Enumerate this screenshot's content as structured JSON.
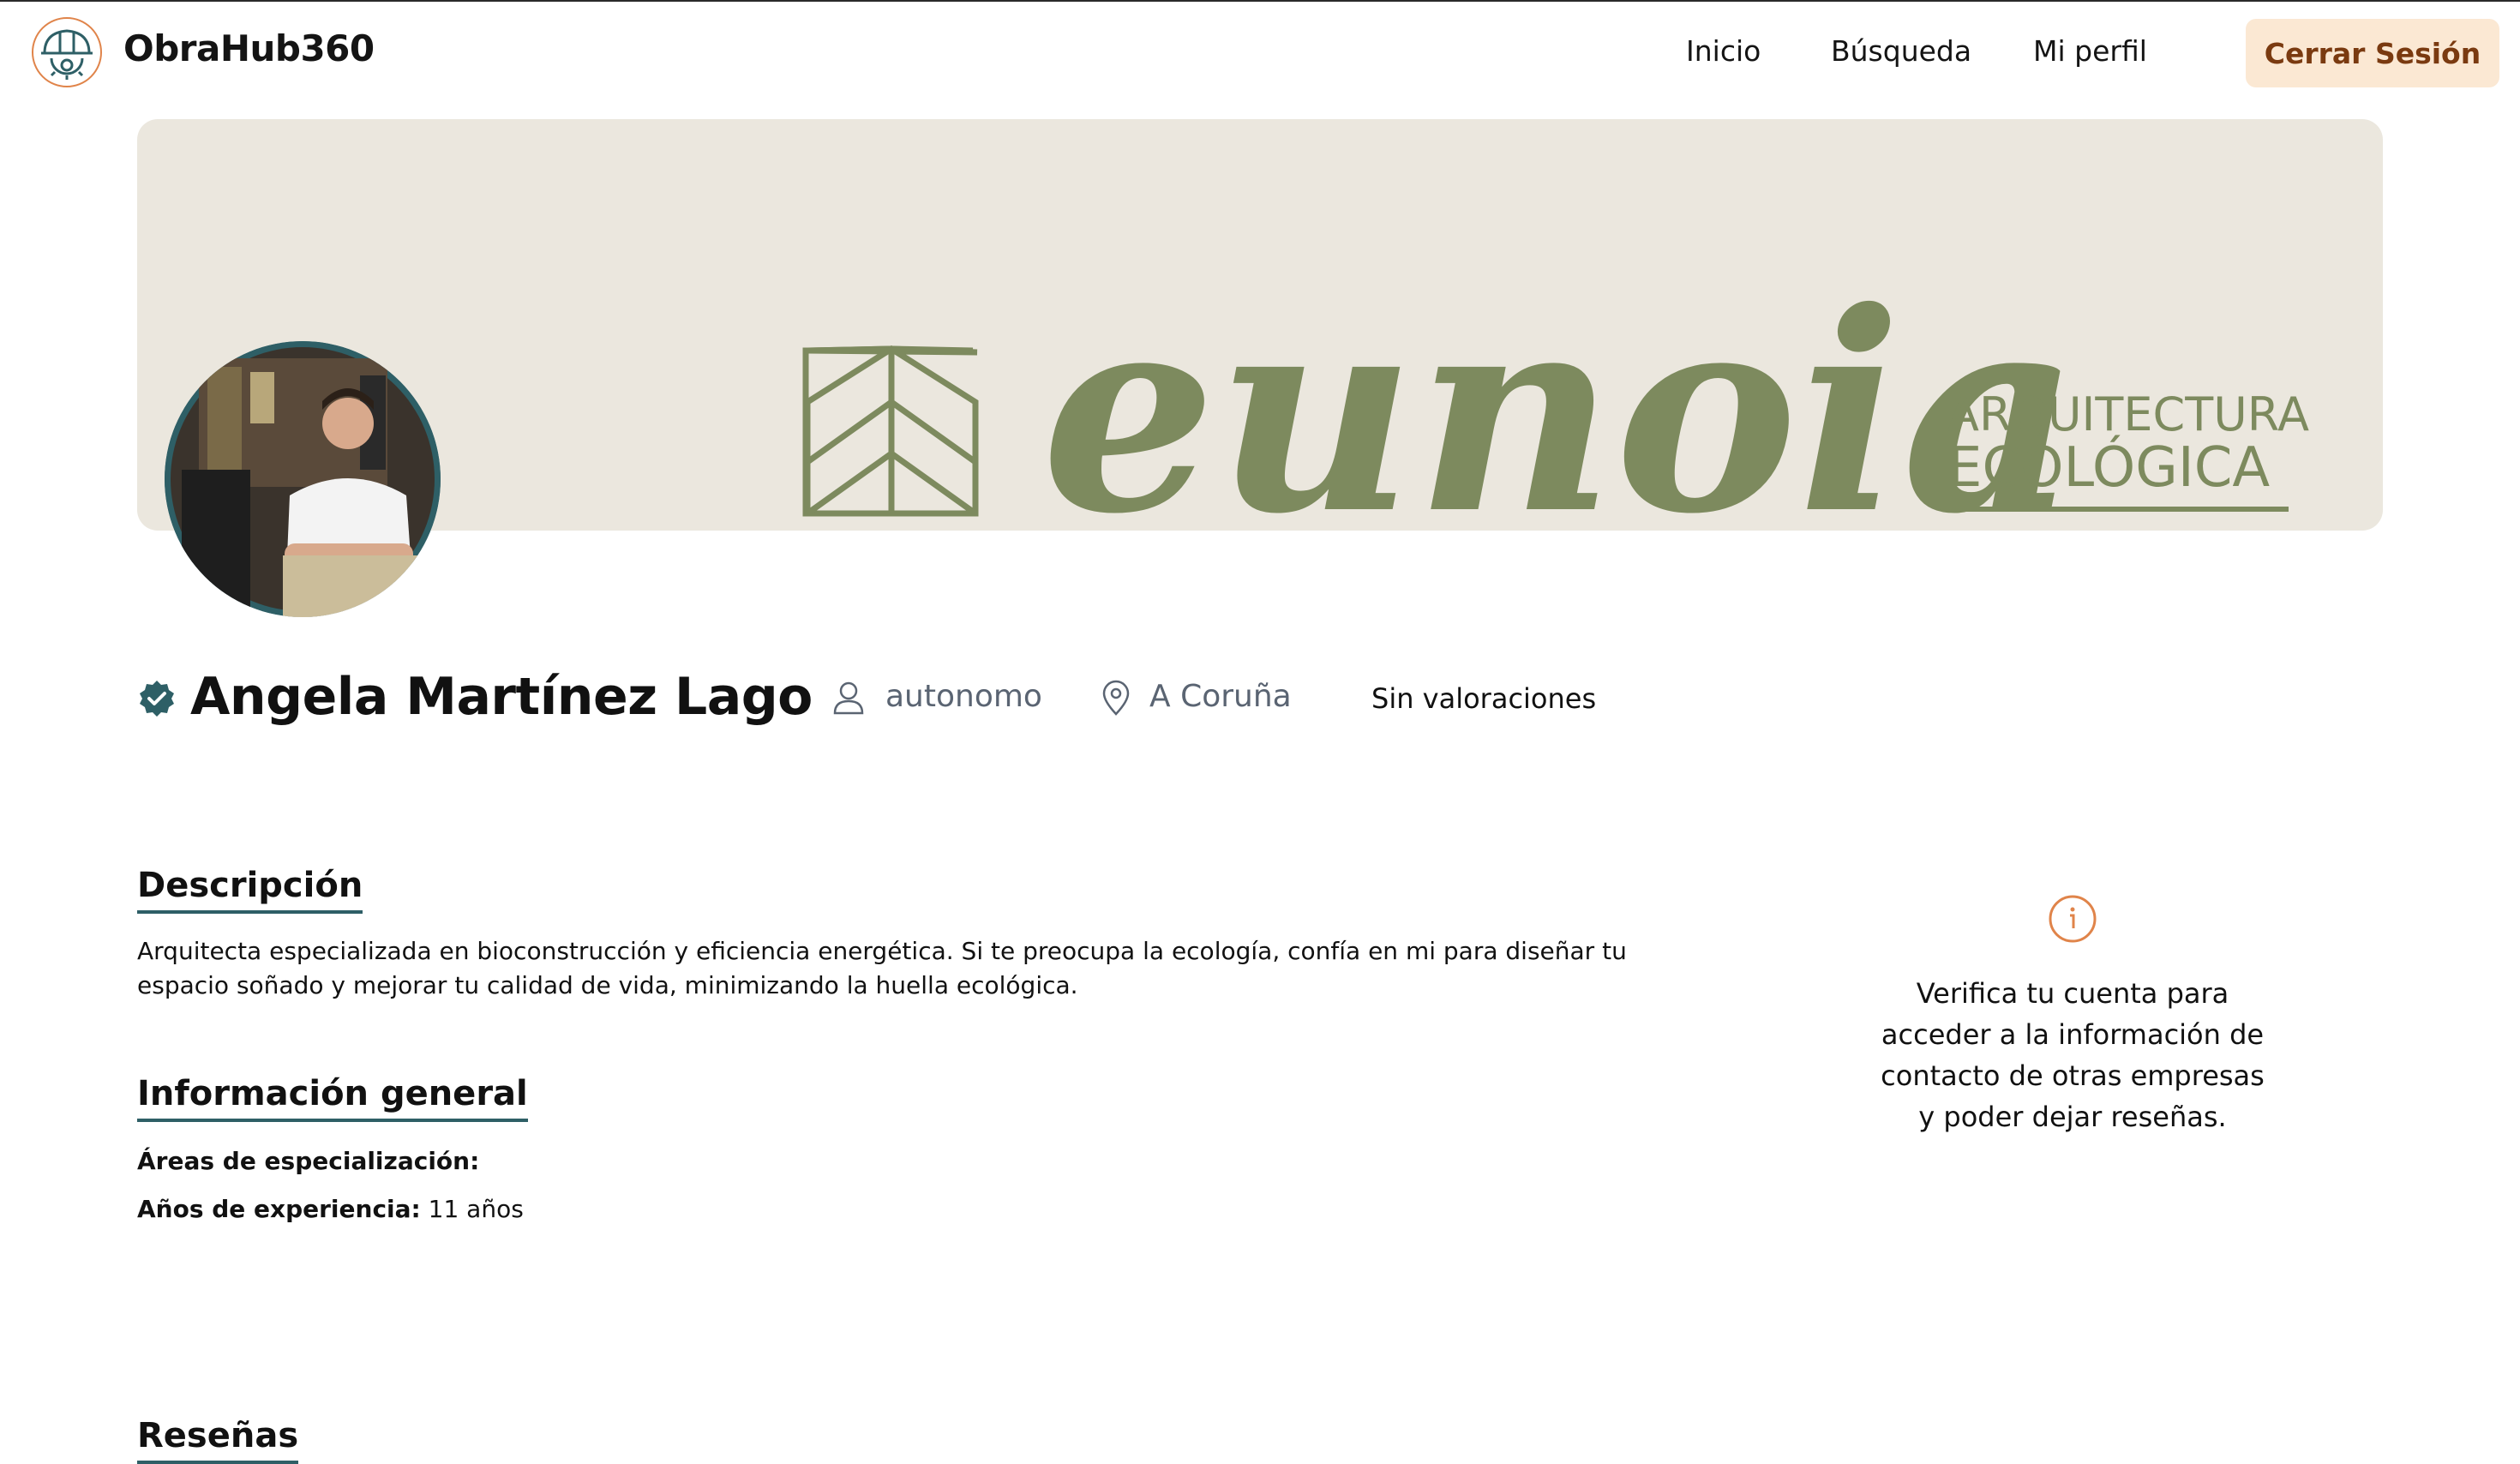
{
  "brand": {
    "name": "ObraHub360"
  },
  "nav": {
    "links": [
      "Inicio",
      "Búsqueda",
      "Mi perfil"
    ],
    "logout_label": "Cerrar Sesión"
  },
  "banner": {
    "logo_word": "eunoia",
    "tagline_line1": "ARQUITECTURA",
    "tagline_line2": "ECOLÓGICA"
  },
  "profile": {
    "name": "Angela Martínez Lago",
    "verified": true,
    "type": "autonomo",
    "location": "A Coruña",
    "ratings": "Sin valoraciones"
  },
  "description": {
    "title": "Descripción",
    "text": "Arquitecta especializada en bioconstrucción y eficiencia energética.  Si te preocupa la ecología, confía en mi para diseñar tu espacio soñado y mejorar tu calidad de vida, minimizando la huella ecológica."
  },
  "general_info": {
    "title": "Información general",
    "specialization_label": "Áreas de especialización:",
    "specialization_value": "",
    "experience_label": "Años de experiencia:",
    "experience_value": "11 años"
  },
  "reviews": {
    "title": "Reseñas"
  },
  "notice": {
    "text": "Verifica tu cuenta para acceder a la información de contacto de otras empresas y poder dejar reseñas."
  },
  "colors": {
    "accent": "#2e5f66",
    "logout_bg": "#fbe8d3",
    "logout_text": "#7a3a10",
    "banner_bg": "#ebe7de",
    "banner_green": "#7d8a5e",
    "info_orange": "#e0844a"
  }
}
